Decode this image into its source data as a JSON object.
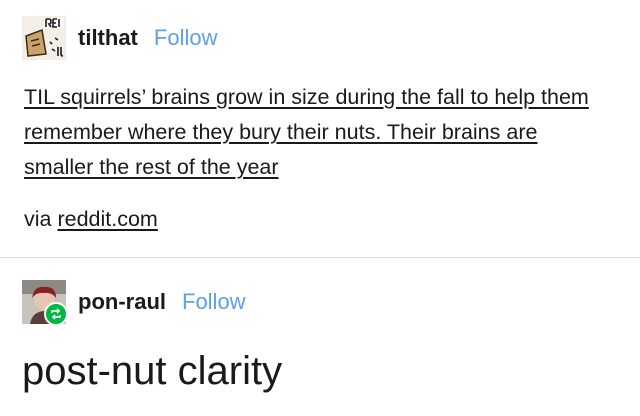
{
  "post1": {
    "username": "tilthat",
    "follow_label": "Follow",
    "avatar_icon": "til-logo-icon",
    "body": "TIL squirrels’ brains grow in size during the fall to help them remember where they bury their nuts. Their brains are smaller the rest of the year",
    "via_prefix": "via ",
    "via_link": "reddit.com"
  },
  "post2": {
    "username": "pon-raul",
    "follow_label": "Follow",
    "avatar_icon": "user-avatar-icon",
    "badge_icon": "reblog-icon",
    "text": "post-nut clarity"
  },
  "colors": {
    "follow": "#5aa1e6",
    "reblog_badge": "#00b843",
    "divider": "#dcdcdc"
  }
}
